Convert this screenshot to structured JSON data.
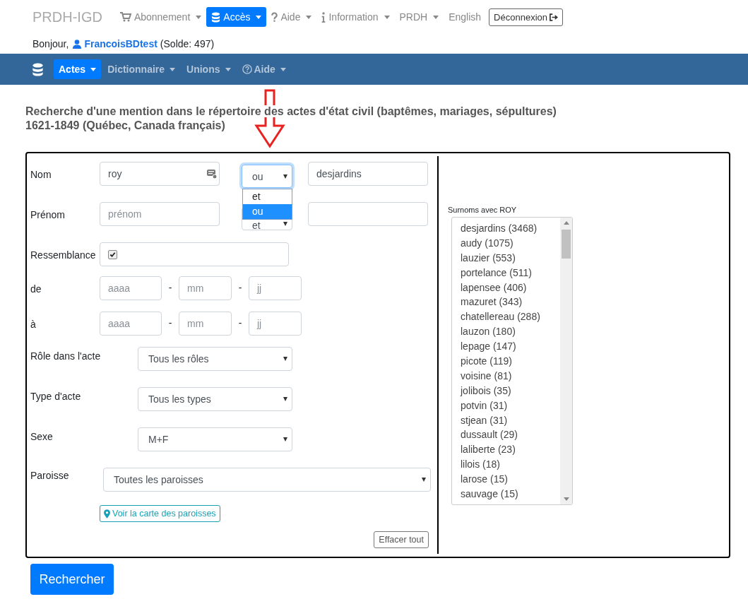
{
  "top_nav": {
    "brand": "PRDH-IGD",
    "items": [
      {
        "label": "Abonnement",
        "selected": false
      },
      {
        "label": "Accès",
        "selected": true
      },
      {
        "label": "Aide",
        "selected": false
      },
      {
        "label": "Information",
        "selected": false
      },
      {
        "label": "PRDH",
        "selected": false
      }
    ],
    "language_link": "English",
    "logout_button": "Déconnexion"
  },
  "greeting": {
    "text": "Bonjour,",
    "user": "FrancoisBDtest",
    "balance": "(Solde: 497)"
  },
  "sub_nav": {
    "items": [
      {
        "label": "Actes",
        "selected": true
      },
      {
        "label": "Dictionnaire",
        "selected": false
      },
      {
        "label": "Unions",
        "selected": false
      },
      {
        "label": "Aide",
        "selected": false
      }
    ]
  },
  "heading": [
    "Recherche d'une mention dans le répertoire des actes d'état civil (baptêmes, mariages, sépultures)",
    "1621-1849 (Québec, Canada français)"
  ],
  "form": {
    "rows": [
      {
        "kind": "name",
        "label": "Nom",
        "value": "roy",
        "operator": "ou",
        "operator_open": true,
        "other_value": "desjardins"
      },
      {
        "kind": "name",
        "label": "Prénom",
        "placeholder": "prénom",
        "operator": "et",
        "operator_open": false
      },
      {
        "kind": "check",
        "label": "Ressemblance",
        "checked": true
      },
      {
        "kind": "date",
        "label": "de",
        "separator": "-",
        "parts": [
          "aaaa",
          "mm",
          "jj"
        ]
      },
      {
        "kind": "date",
        "label": "à",
        "separator": "-",
        "parts": [
          "aaaa",
          "mm",
          "jj"
        ]
      },
      {
        "kind": "select",
        "label": "Rôle dans l'acte",
        "value": "Tous les rôles"
      },
      {
        "kind": "select",
        "label": "Type d'acte",
        "value": "Tous les types"
      },
      {
        "kind": "select",
        "label": "Sexe",
        "value": "M+F"
      },
      {
        "kind": "wide",
        "label": "Paroisse",
        "value": "Toutes les paroisses"
      }
    ],
    "operator_options": [
      {
        "label": "et",
        "selected": false
      },
      {
        "label": "ou",
        "selected": true
      }
    ],
    "map_button": "Voir la carte des paroisses",
    "clear_button": "Effacer tout"
  },
  "nicknames": {
    "title": "Surnoms avec ROY",
    "items": [
      "desjardins (3468)",
      "audy (1075)",
      "lauzier (553)",
      "portelance (511)",
      "lapensee (406)",
      "mazuret (343)",
      "chatellereau (288)",
      "lauzon (180)",
      "lepage (147)",
      "picote (119)",
      "voisine (81)",
      "jolibois (35)",
      "potvin (31)",
      "stjean (31)",
      "dussault (29)",
      "laliberte (23)",
      "lilois (18)",
      "larose (15)",
      "sauvage (15)"
    ]
  },
  "search_button": "Rechercher"
}
